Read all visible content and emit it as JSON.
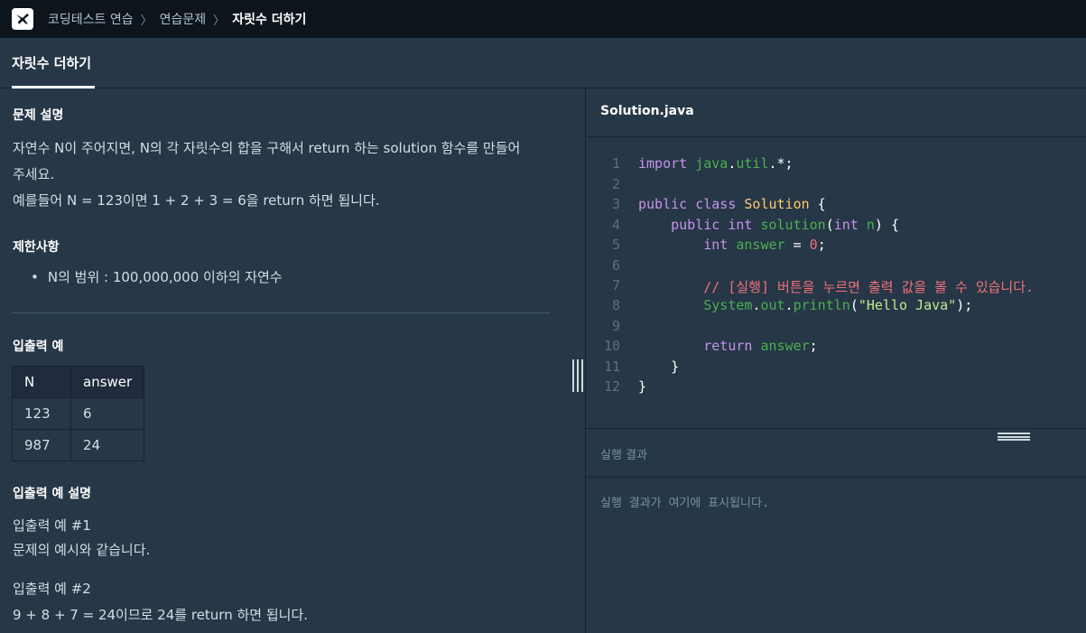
{
  "breadcrumb": [
    "코딩테스트 연습",
    "연습문제",
    "자릿수 더하기"
  ],
  "tab": {
    "label": "자릿수 더하기"
  },
  "problem": {
    "desc_title": "문제 설명",
    "desc_line1": "자연수 N이 주어지면, N의 각 자릿수의 합을 구해서 return 하는 solution 함수를 만들어",
    "desc_line2": "주세요.",
    "desc_line3": "예를들어 N = 123이면 1 + 2 + 3 = 6을 return 하면 됩니다.",
    "constraints_title": "제한사항",
    "constraint1": "N의 범위 : 100,000,000 이하의 자연수",
    "io_title": "입출력 예",
    "table": {
      "headers": [
        "N",
        "answer"
      ],
      "rows": [
        [
          "123",
          "6"
        ],
        [
          "987",
          "24"
        ]
      ]
    },
    "io_desc_title": "입출력 예 설명",
    "ex1_title": "입출력 예 #1",
    "ex1_text": "문제의 예시와 같습니다.",
    "ex2_title": "입출력 예 #2",
    "ex2_text": "9 + 8 + 7 = 24이므로 24를 return 하면 됩니다."
  },
  "editor": {
    "filename": "Solution.java",
    "line_numbers": [
      "1",
      "2",
      "3",
      "4",
      "5",
      "6",
      "7",
      "8",
      "9",
      "10",
      "11",
      "12"
    ],
    "lines": [
      "import java.util.*;",
      "",
      "public class Solution {",
      "    public int solution(int n) {",
      "        int answer = 0;",
      "",
      "        // [실행] 버튼을 누르면 출력 값을 볼 수 있습니다.",
      "        System.out.println(\"Hello Java\");",
      "",
      "        return answer;",
      "    }",
      "}"
    ]
  },
  "result": {
    "title": "실행 결과",
    "placeholder": "실행 결과가 여기에 표시됩니다."
  }
}
